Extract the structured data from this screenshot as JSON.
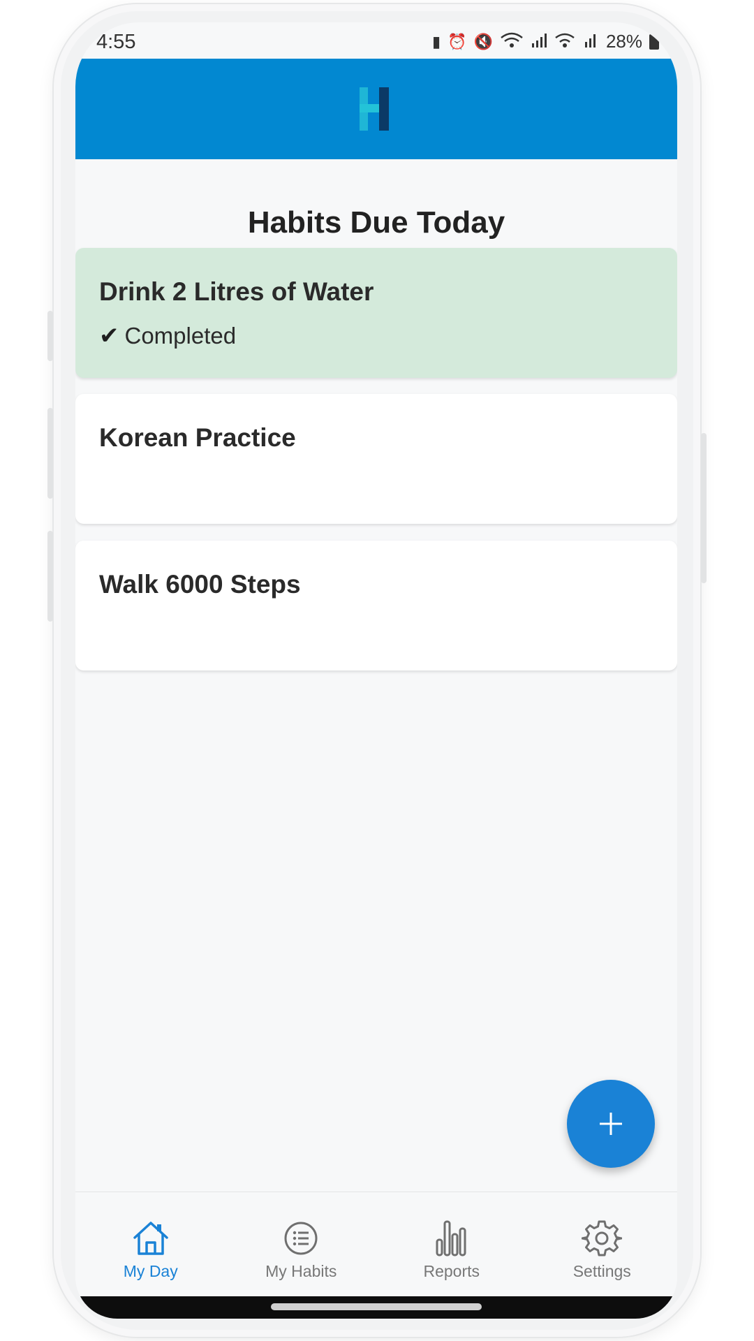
{
  "status_bar": {
    "time": "4:55",
    "battery": "28%"
  },
  "header": {
    "logo_icon": "habit-logo-icon",
    "brand_color": "#0288d1"
  },
  "page": {
    "title": "Habits Due Today"
  },
  "habits": [
    {
      "name": "Drink 2 Litres of Water",
      "status": "Completed",
      "completed": true,
      "check_glyph": "✔"
    },
    {
      "name": "Korean Practice",
      "status": "",
      "completed": false
    },
    {
      "name": "Walk 6000 Steps",
      "status": "",
      "completed": false
    }
  ],
  "fab": {
    "icon": "plus-icon",
    "color": "#1a82d6"
  },
  "nav": {
    "items": [
      {
        "label": "My Day",
        "icon": "home-icon",
        "active": true
      },
      {
        "label": "My Habits",
        "icon": "list-icon",
        "active": false
      },
      {
        "label": "Reports",
        "icon": "bar-chart-icon",
        "active": false
      },
      {
        "label": "Settings",
        "icon": "gear-icon",
        "active": false
      }
    ],
    "active_color": "#1a82d6",
    "inactive_color": "#777777"
  }
}
